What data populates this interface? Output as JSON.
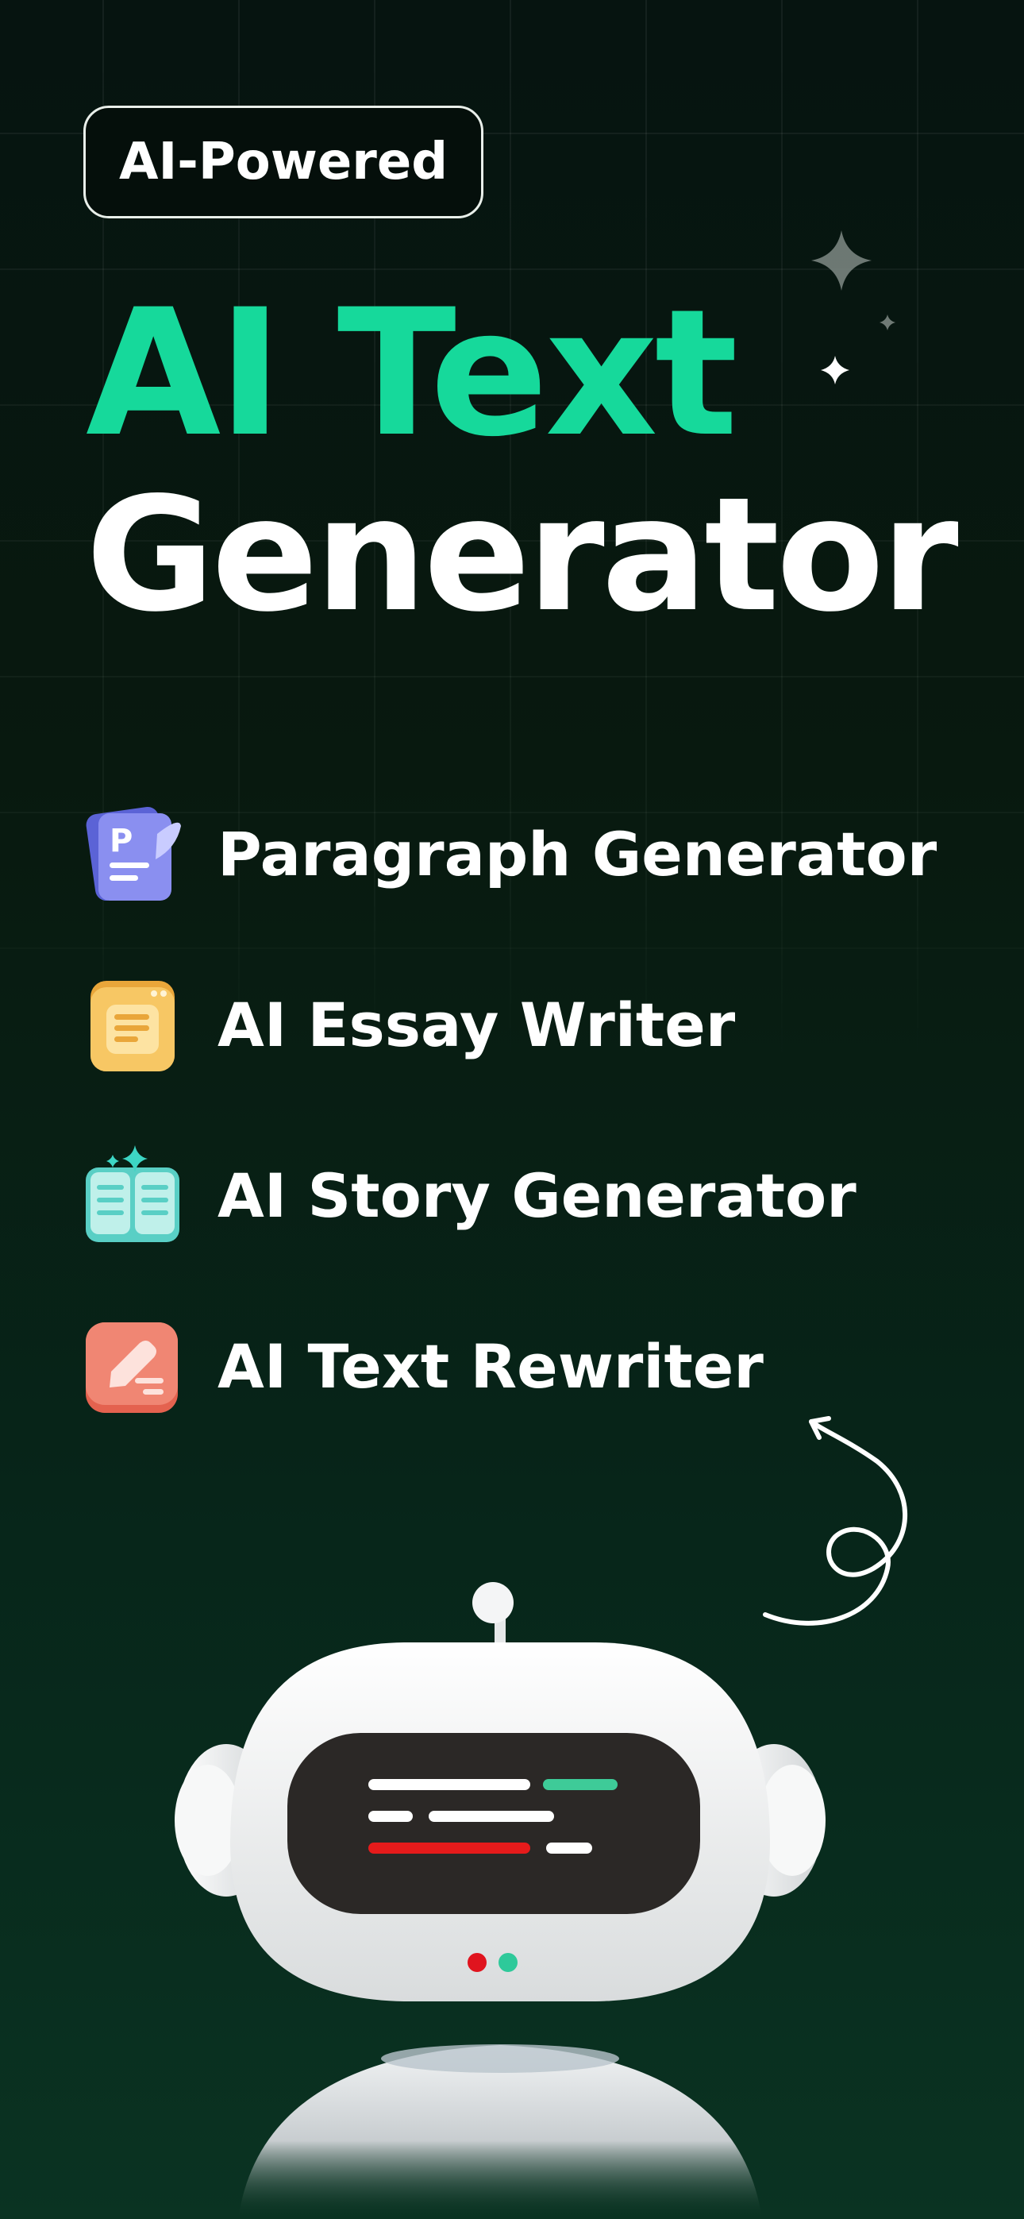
{
  "badge": {
    "label": "AI-Powered"
  },
  "hero": {
    "title_line1": "AI Text",
    "title_line2": "Generator"
  },
  "features": [
    {
      "label": "Paragraph Generator",
      "icon": "paragraph-document-icon"
    },
    {
      "label": "AI Essay Writer",
      "icon": "essay-notepad-icon"
    },
    {
      "label": "AI Story Generator",
      "icon": "open-book-sparkle-icon"
    },
    {
      "label": "AI Text Rewriter",
      "icon": "pen-edit-icon"
    }
  ],
  "colors": {
    "accent": "#16d99b",
    "background_top": "#061410",
    "background_bottom": "#0a3322",
    "text": "#ffffff"
  }
}
